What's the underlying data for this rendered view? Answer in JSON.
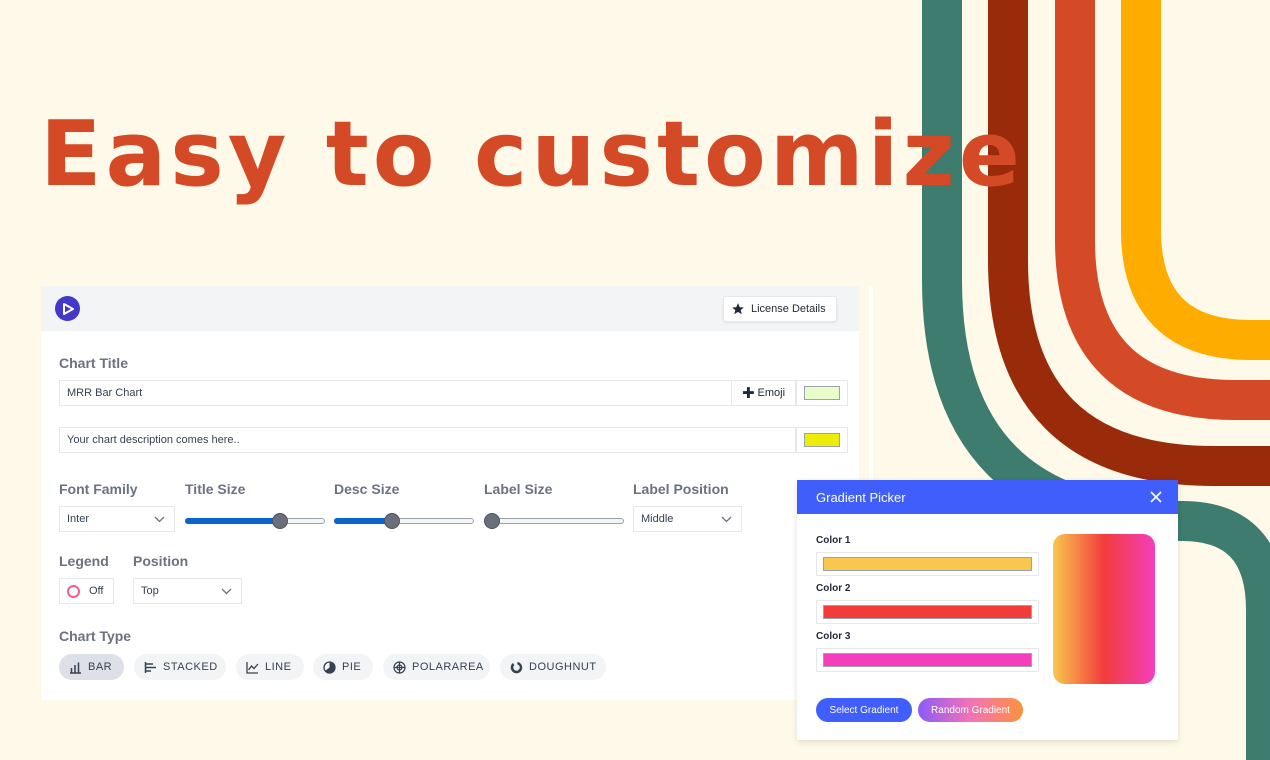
{
  "hero": {
    "headline": "Easy to customize"
  },
  "colors": {
    "background": "#fef9e8",
    "headline": "#d44a27",
    "stripes": [
      "#3d7c6e",
      "#992a0a",
      "#d44a27",
      "#ffac00"
    ],
    "accent": "#3f5efb",
    "logo": "#4338ca"
  },
  "topbar": {
    "logo_icon": "play-logo-icon",
    "license_icon": "star-icon",
    "license_label": "License Details"
  },
  "chart_title": {
    "label": "Chart Title",
    "value": "MRR Bar Chart",
    "emoji_label": "Emoji",
    "emoji_icon": "plus-icon",
    "title_color": "#e8fdc9"
  },
  "description": {
    "value": "Your chart description comes here..",
    "color": "#eced0b"
  },
  "controls": {
    "font_family": {
      "label": "Font Family",
      "value": "Inter"
    },
    "title_size": {
      "label": "Title Size",
      "level": 0.7
    },
    "desc_size": {
      "label": "Desc Size",
      "level": 0.4
    },
    "label_size": {
      "label": "Label Size",
      "level": 0.0
    },
    "label_position": {
      "label": "Label Position",
      "value": "Middle"
    },
    "legend": {
      "label": "Legend",
      "value": "Off"
    },
    "position": {
      "label": "Position",
      "value": "Top"
    }
  },
  "chart_type": {
    "label": "Chart Type",
    "options": [
      {
        "label": "BAR",
        "icon": "bar-chart-icon",
        "active": true
      },
      {
        "label": "STACKED",
        "icon": "stacked-bar-icon",
        "active": false
      },
      {
        "label": "LINE",
        "icon": "line-chart-icon",
        "active": false
      },
      {
        "label": "PIE",
        "icon": "pie-chart-icon",
        "active": false
      },
      {
        "label": "POLARAREA",
        "icon": "polar-area-icon",
        "active": false
      },
      {
        "label": "DOUGHNUT",
        "icon": "doughnut-icon",
        "active": false
      }
    ]
  },
  "gradient_picker": {
    "title": "Gradient Picker",
    "close_icon": "close-icon",
    "colors": [
      {
        "label": "Color 1",
        "value": "#f9c74f"
      },
      {
        "label": "Color 2",
        "value": "#f23c3c"
      },
      {
        "label": "Color 3",
        "value": "#f43fbd"
      }
    ],
    "select_label": "Select Gradient",
    "random_label": "Random Gradient"
  }
}
